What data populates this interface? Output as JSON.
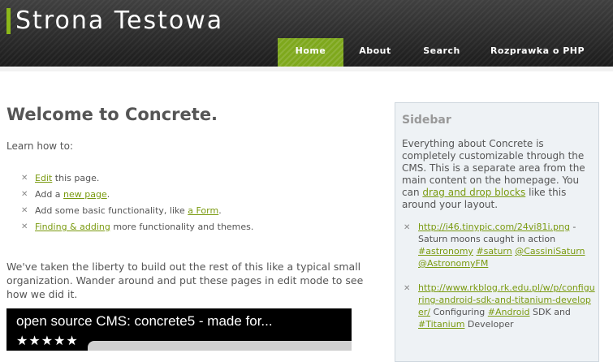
{
  "header": {
    "site_title": "Strona Testowa",
    "accent_color": "#8cb81a",
    "nav": [
      {
        "label": "Home",
        "active": true
      },
      {
        "label": "About",
        "active": false
      },
      {
        "label": "Search",
        "active": false
      },
      {
        "label": "Rozprawka o PHP",
        "active": false
      }
    ]
  },
  "main": {
    "title": "Welcome to Concrete.",
    "intro": "Learn how to:",
    "list_icon": "x-icon",
    "howto": [
      {
        "link1": "Edit",
        "text1": " this page."
      },
      {
        "text1": "Add a ",
        "link1": "new page",
        "text2": "."
      },
      {
        "text1": "Add some basic functionality, like ",
        "link1": "a Form",
        "text2": "."
      },
      {
        "link1": "Finding & adding",
        "text1": " more functionality and themes."
      }
    ],
    "paragraph": "We've taken the liberty to build out the rest of this like a typical small organization. Wander around and put these pages in edit mode to see how we did it.",
    "video": {
      "title": "open source CMS: concrete5 - made for...",
      "stars": "★★★★★"
    }
  },
  "sidebar": {
    "title": "Sidebar",
    "text_part1": "Everything about Concrete is completely customizable through the CMS. This is a separate area from the main content on the homepage. You can ",
    "text_link": "drag and drop blocks",
    "text_part2": " like this around your layout.",
    "tweets": [
      {
        "url": "http://i46.tinypic.com/24vi81i.png",
        "text1": " - Saturn moons caught in action ",
        "tags": [
          "#astronomy",
          "#saturn",
          "@CassiniSaturn",
          "@AstronomyFM"
        ]
      },
      {
        "url": "http://www.rkblog.rk.edu.pl/w/p/configuring-android-sdk-and-titanium-developer/",
        "text1": " Configuring ",
        "tag1": "#Android",
        "text2": " SDK and ",
        "tag2": "#Titanium",
        "text3": " Developer"
      }
    ]
  }
}
